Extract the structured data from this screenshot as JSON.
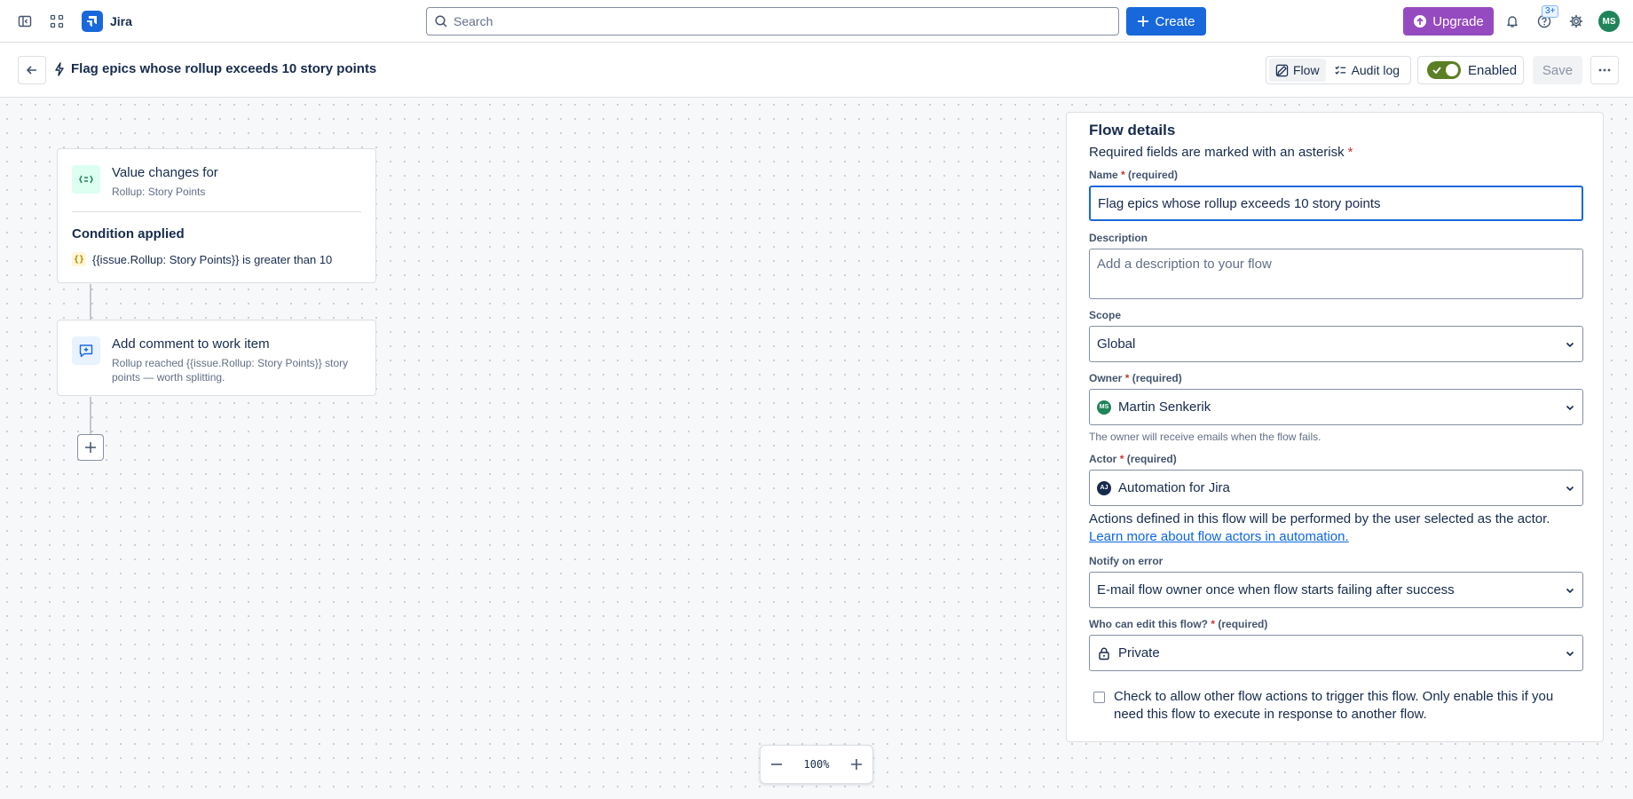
{
  "app": {
    "name": "Jira",
    "brand_color": "#1868db"
  },
  "topnav": {
    "search_placeholder": "Search",
    "create_label": "Create",
    "upgrade_label": "Upgrade",
    "help_badge": "3+",
    "avatar_initials": "MS"
  },
  "header": {
    "title": "Flag epics whose rollup exceeds 10 story points",
    "tab_flow": "Flow",
    "tab_audit_log": "Audit log",
    "enabled_label": "Enabled",
    "save_label": "Save"
  },
  "canvas": {
    "trigger": {
      "title": "Value changes for",
      "subtitle": "Rollup: Story Points",
      "condition_title": "Condition applied",
      "condition_text": "{{issue.Rollup: Story Points}} is greater than 10"
    },
    "action": {
      "title": "Add comment to work item",
      "subtitle": "Rollup reached {{issue.Rollup: Story Points}} story points — worth splitting."
    },
    "zoom_level": "100%"
  },
  "panel": {
    "title": "Flow details",
    "required_note": "Required fields are marked with an asterisk",
    "name_label": "Name",
    "name_value": "Flag epics whose rollup exceeds 10 story points",
    "required_text": "(required)",
    "description_label": "Description",
    "description_placeholder": "Add a description to your flow",
    "scope_label": "Scope",
    "scope_value": "Global",
    "owner_label": "Owner",
    "owner_value": "Martin Senkerik",
    "owner_initials": "MS",
    "owner_helper": "The owner will receive emails when the flow fails.",
    "actor_label": "Actor",
    "actor_value": "Automation for Jira",
    "actor_initials": "AJ",
    "actor_help": "Actions defined in this flow will be performed by the user selected as the actor.",
    "actor_link": "Learn more about flow actors in automation.",
    "notify_label": "Notify on error",
    "notify_value": "E-mail flow owner once when flow starts failing after success",
    "edit_label": "Who can edit this flow?",
    "edit_value": "Private",
    "allow_trigger_text": "Check to allow other flow actions to trigger this flow. Only enable this if you need this flow to execute in response to another flow."
  }
}
